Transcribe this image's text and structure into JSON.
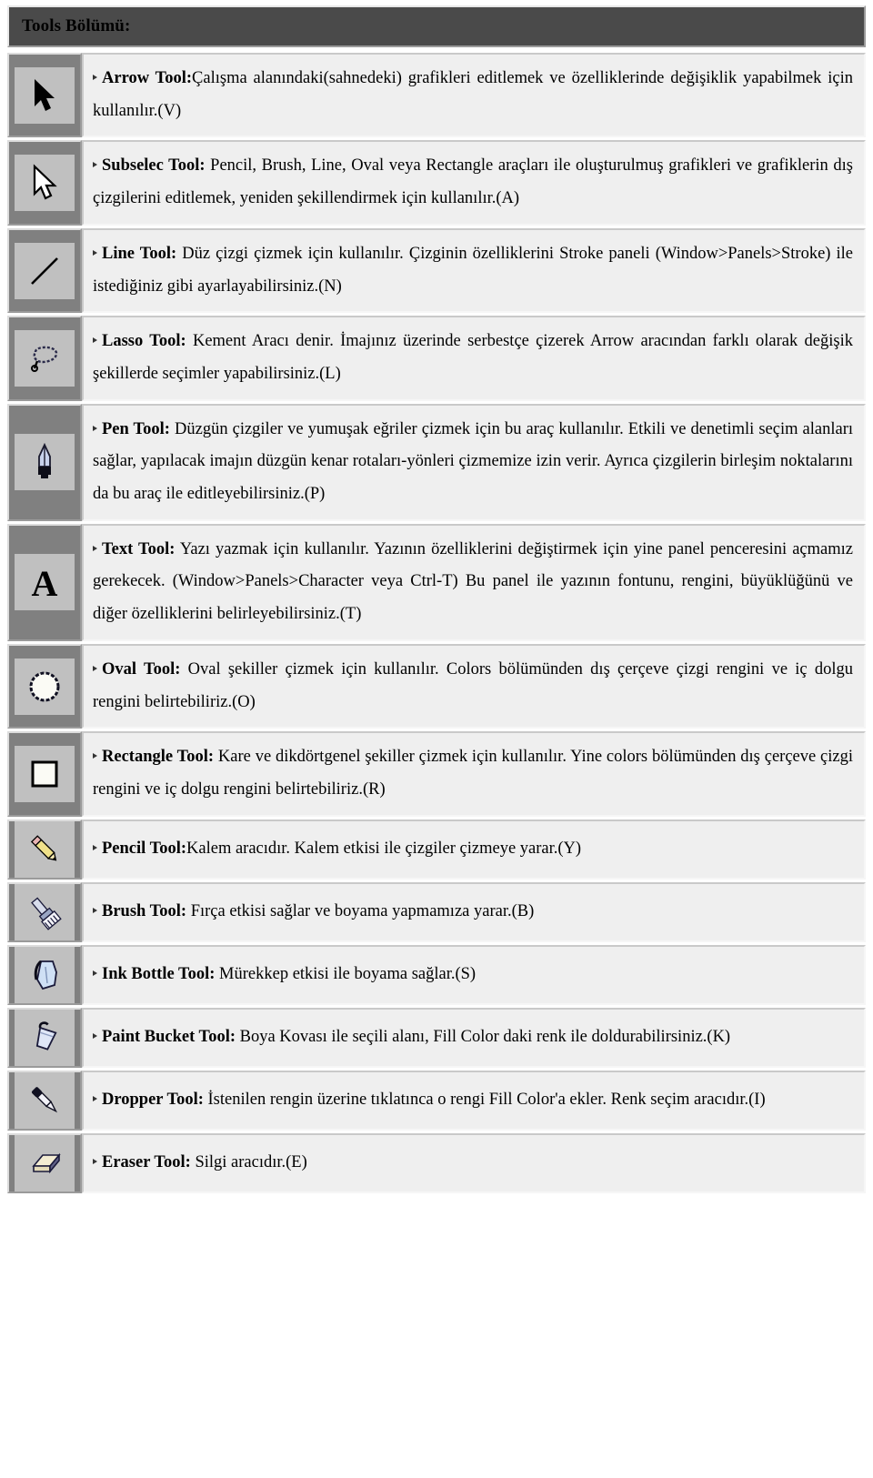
{
  "header": {
    "title": "Tools Bölümü:"
  },
  "colors": {
    "header_band": "#4a4a4a",
    "icon_cell_outer": "#808080",
    "icon_plate": "#c0c0c0",
    "description_cell": "#efefef",
    "text": "#000000"
  },
  "tools": [
    {
      "icon": "arrow-cursor-icon",
      "name": "Arrow Tool:",
      "name_space_after": false,
      "description": "Çalışma alanındaki(sahnedeki) grafikleri editlemek ve özelliklerinde değişiklik yapabilmek için kullanılır.(V)"
    },
    {
      "icon": "subselect-cursor-icon",
      "name": "Subselec Tool:",
      "name_space_after": true,
      "description": "Pencil, Brush, Line, Oval veya Rectangle araçları ile oluşturulmuş grafikleri ve grafiklerin dış çizgilerini editlemek, yeniden şekillendirmek için kullanılır.(A)"
    },
    {
      "icon": "line-icon",
      "name": "Line Tool:",
      "name_space_after": true,
      "description": "Düz çizgi çizmek için kullanılır. Çizginin özelliklerini Stroke paneli (Window>Panels>Stroke) ile istediğiniz gibi ayarlayabilirsiniz.(N)"
    },
    {
      "icon": "lasso-icon",
      "name": "Lasso Tool:",
      "name_space_after": true,
      "description": "Kement Aracı denir. İmajınız üzerinde serbestçe çizerek Arrow aracından farklı olarak değişik şekillerde seçimler yapabilirsiniz.(L)"
    },
    {
      "icon": "pen-nib-icon",
      "name": "Pen Tool:",
      "name_space_after": true,
      "description": "Düzgün çizgiler ve yumuşak eğriler çizmek için bu araç kullanılır. Etkili ve denetimli seçim alanları sağlar, yapılacak imajın düzgün kenar rotaları-yönleri çizmemize izin verir. Ayrıca çizgilerin birleşim noktalarını da bu araç ile editleyebilirsiniz.(P)"
    },
    {
      "icon": "text-a-icon",
      "name": "Text Tool:",
      "name_space_after": true,
      "description": "Yazı yazmak için kullanılır. Yazının özelliklerini değiştirmek için yine panel penceresini açmamız gerekecek. (Window>Panels>Character veya Ctrl-T) Bu panel ile yazının fontunu, rengini, büyüklüğünü ve diğer özelliklerini belirleyebilirsiniz.(T)"
    },
    {
      "icon": "oval-icon",
      "name": "Oval Tool:",
      "name_space_after": true,
      "description": "Oval şekiller çizmek için kullanılır. Colors bölümünden dış çerçeve çizgi rengini ve iç dolgu rengini belirtebiliriz.(O)"
    },
    {
      "icon": "rectangle-icon",
      "name": "Rectangle Tool:",
      "name_space_after": true,
      "description": "Kare ve dikdörtgenel şekiller çizmek için kullanılır. Yine colors bölümünden dış çerçeve çizgi rengini ve iç dolgu rengini belirtebiliriz.(R)"
    },
    {
      "icon": "pencil-icon",
      "name": "Pencil Tool:",
      "name_space_after": false,
      "description": "Kalem aracıdır. Kalem etkisi ile çizgiler çizmeye yarar.(Y)"
    },
    {
      "icon": "brush-icon",
      "name": "Brush Tool:",
      "name_space_after": true,
      "description": "Fırça etkisi sağlar ve boyama yapmamıza yarar.(B)"
    },
    {
      "icon": "ink-bottle-icon",
      "name": "Ink Bottle Tool:",
      "name_space_after": true,
      "description": "Mürekkep etkisi ile boyama sağlar.(S)"
    },
    {
      "icon": "paint-bucket-icon",
      "name": "Paint Bucket Tool:",
      "name_space_after": true,
      "description": "Boya Kovası ile seçili alanı, Fill Color daki renk ile doldurabilirsiniz.(K)"
    },
    {
      "icon": "dropper-icon",
      "name": "Dropper Tool:",
      "name_space_after": true,
      "description": "İstenilen rengin üzerine tıklatınca o rengi Fill Color'a ekler. Renk seçim aracıdır.(I)"
    },
    {
      "icon": "eraser-icon",
      "name": "Eraser Tool:",
      "name_space_after": true,
      "description": "Silgi aracıdır.(E)"
    }
  ]
}
